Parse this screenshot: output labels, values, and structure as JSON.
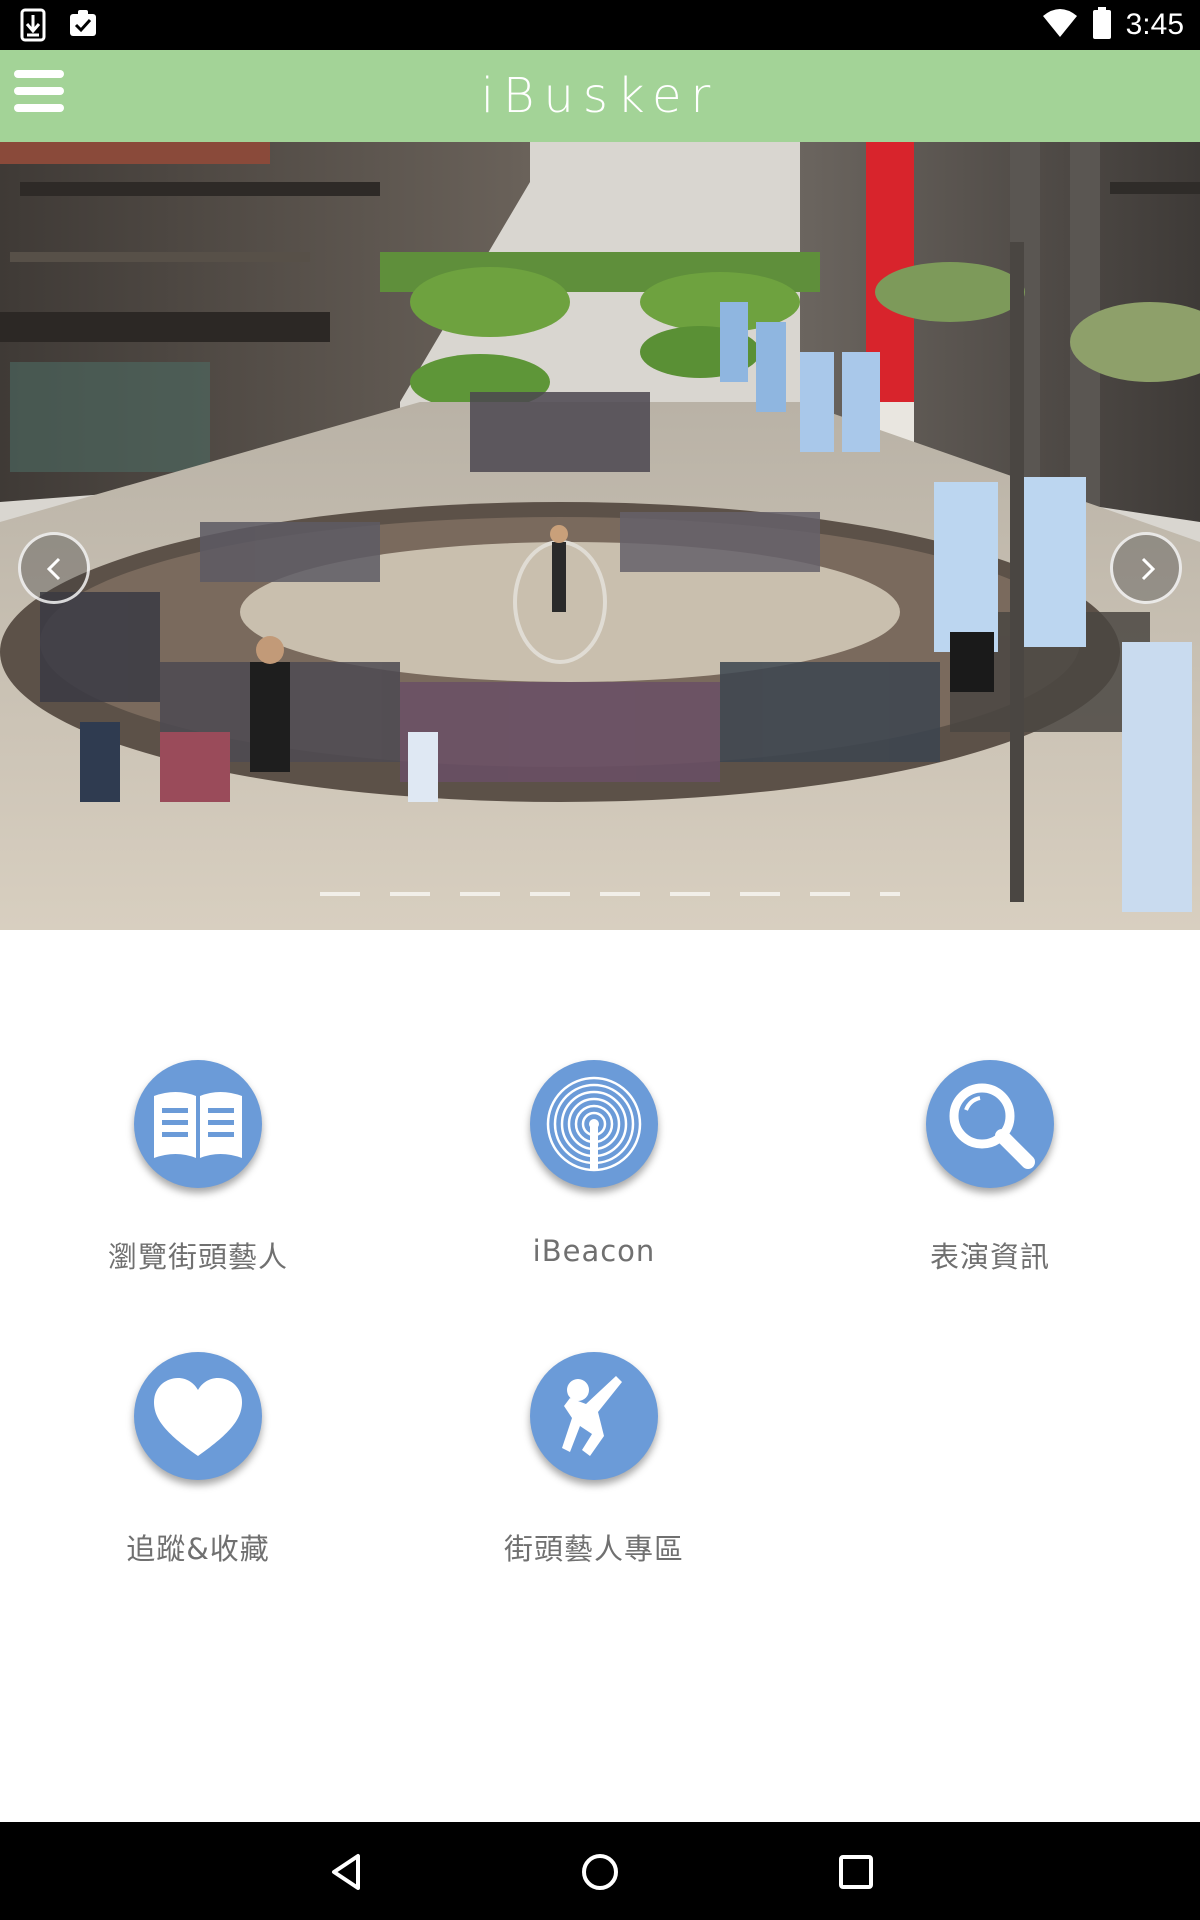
{
  "status_bar": {
    "time": "3:45",
    "icons": [
      "download-icon",
      "clipboard-check-icon",
      "wifi-icon",
      "battery-icon"
    ]
  },
  "app_bar": {
    "title": "iBusker",
    "menu_icon": "hamburger-menu-icon",
    "background_color": "#a3d397"
  },
  "banner": {
    "description_icon": "street-performance-photo",
    "prev_icon": "chevron-left-icon",
    "next_icon": "chevron-right-icon"
  },
  "menu": {
    "items": [
      {
        "label": "瀏覽街頭藝人",
        "icon": "open-book-icon"
      },
      {
        "label": "iBeacon",
        "icon": "beacon-signal-icon"
      },
      {
        "label": "表演資訊",
        "icon": "search-icon"
      },
      {
        "label": "追蹤&收藏",
        "icon": "heart-icon"
      },
      {
        "label": "街頭藝人專區",
        "icon": "dancing-person-icon"
      }
    ],
    "circle_color": "#6b9bd8"
  },
  "nav_bar": {
    "icons": [
      "back-icon",
      "home-icon",
      "recents-icon"
    ]
  }
}
